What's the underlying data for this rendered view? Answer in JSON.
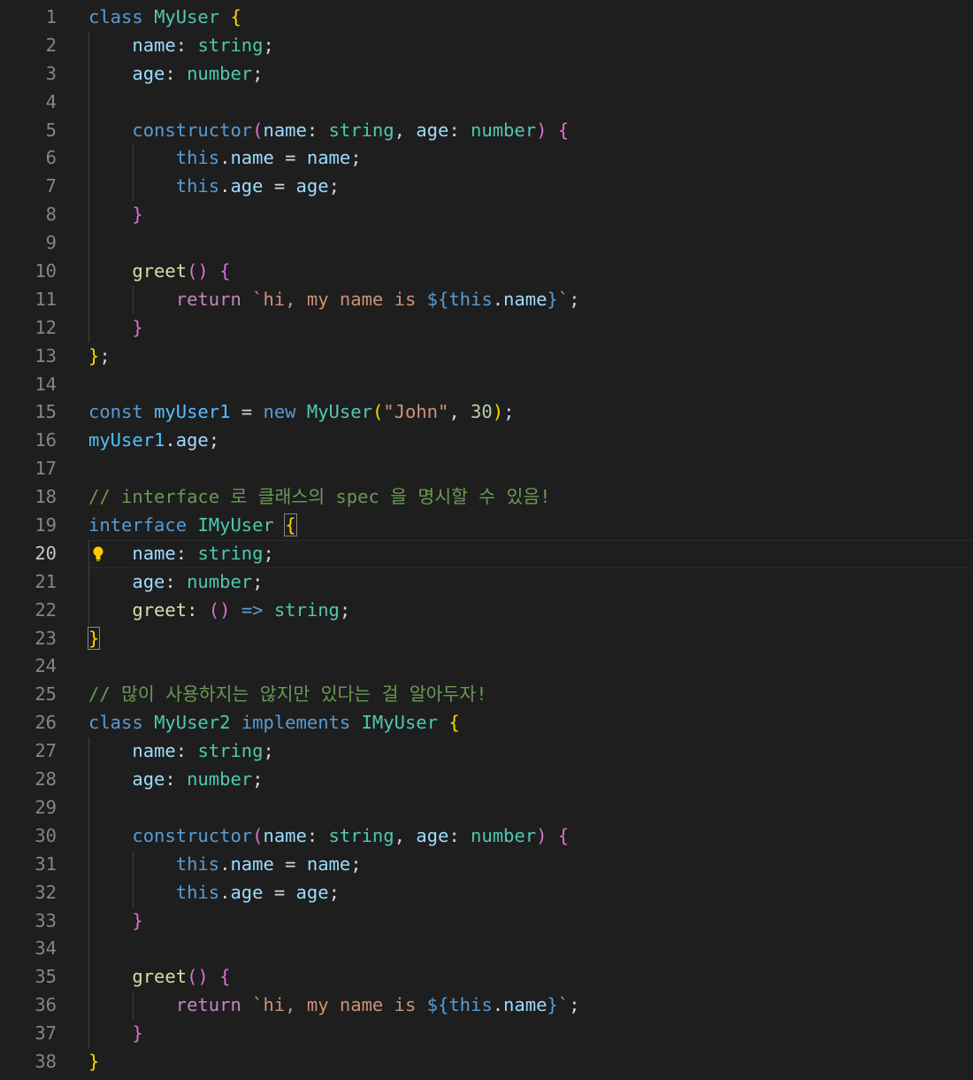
{
  "editor": {
    "current_line": 20,
    "lines": [
      {
        "n": "1",
        "tokens": [
          {
            "t": "class",
            "c": "kw"
          },
          {
            "t": " ",
            "c": "pun"
          },
          {
            "t": "MyUser",
            "c": "cls"
          },
          {
            "t": " ",
            "c": "pun"
          },
          {
            "t": "{",
            "c": "b1"
          }
        ]
      },
      {
        "n": "2",
        "tokens": [
          {
            "t": "    ",
            "c": "pun"
          },
          {
            "t": "name",
            "c": "var"
          },
          {
            "t": ": ",
            "c": "pun"
          },
          {
            "t": "string",
            "c": "cls"
          },
          {
            "t": ";",
            "c": "pun"
          }
        ]
      },
      {
        "n": "3",
        "tokens": [
          {
            "t": "    ",
            "c": "pun"
          },
          {
            "t": "age",
            "c": "var"
          },
          {
            "t": ": ",
            "c": "pun"
          },
          {
            "t": "number",
            "c": "cls"
          },
          {
            "t": ";",
            "c": "pun"
          }
        ]
      },
      {
        "n": "4",
        "tokens": []
      },
      {
        "n": "5",
        "tokens": [
          {
            "t": "    ",
            "c": "pun"
          },
          {
            "t": "constructor",
            "c": "kw"
          },
          {
            "t": "(",
            "c": "b2"
          },
          {
            "t": "name",
            "c": "var"
          },
          {
            "t": ": ",
            "c": "pun"
          },
          {
            "t": "string",
            "c": "cls"
          },
          {
            "t": ", ",
            "c": "pun"
          },
          {
            "t": "age",
            "c": "var"
          },
          {
            "t": ": ",
            "c": "pun"
          },
          {
            "t": "number",
            "c": "cls"
          },
          {
            "t": ")",
            "c": "b2"
          },
          {
            "t": " ",
            "c": "pun"
          },
          {
            "t": "{",
            "c": "b2"
          }
        ]
      },
      {
        "n": "6",
        "tokens": [
          {
            "t": "        ",
            "c": "pun"
          },
          {
            "t": "this",
            "c": "kw"
          },
          {
            "t": ".",
            "c": "pun"
          },
          {
            "t": "name",
            "c": "var"
          },
          {
            "t": " = ",
            "c": "pun"
          },
          {
            "t": "name",
            "c": "var"
          },
          {
            "t": ";",
            "c": "pun"
          }
        ]
      },
      {
        "n": "7",
        "tokens": [
          {
            "t": "        ",
            "c": "pun"
          },
          {
            "t": "this",
            "c": "kw"
          },
          {
            "t": ".",
            "c": "pun"
          },
          {
            "t": "age",
            "c": "var"
          },
          {
            "t": " = ",
            "c": "pun"
          },
          {
            "t": "age",
            "c": "var"
          },
          {
            "t": ";",
            "c": "pun"
          }
        ]
      },
      {
        "n": "8",
        "tokens": [
          {
            "t": "    ",
            "c": "pun"
          },
          {
            "t": "}",
            "c": "b2"
          }
        ]
      },
      {
        "n": "9",
        "tokens": []
      },
      {
        "n": "10",
        "tokens": [
          {
            "t": "    ",
            "c": "pun"
          },
          {
            "t": "greet",
            "c": "fn"
          },
          {
            "t": "()",
            "c": "b2"
          },
          {
            "t": " ",
            "c": "pun"
          },
          {
            "t": "{",
            "c": "b2"
          }
        ]
      },
      {
        "n": "11",
        "tokens": [
          {
            "t": "        ",
            "c": "pun"
          },
          {
            "t": "return",
            "c": "ctl"
          },
          {
            "t": " ",
            "c": "pun"
          },
          {
            "t": "`hi, my name is ",
            "c": "str"
          },
          {
            "t": "${",
            "c": "kw"
          },
          {
            "t": "this",
            "c": "kw"
          },
          {
            "t": ".",
            "c": "pun"
          },
          {
            "t": "name",
            "c": "var"
          },
          {
            "t": "}",
            "c": "kw"
          },
          {
            "t": "`",
            "c": "str"
          },
          {
            "t": ";",
            "c": "pun"
          }
        ]
      },
      {
        "n": "12",
        "tokens": [
          {
            "t": "    ",
            "c": "pun"
          },
          {
            "t": "}",
            "c": "b2"
          }
        ]
      },
      {
        "n": "13",
        "tokens": [
          {
            "t": "}",
            "c": "b1"
          },
          {
            "t": ";",
            "c": "pun"
          }
        ]
      },
      {
        "n": "14",
        "tokens": []
      },
      {
        "n": "15",
        "tokens": [
          {
            "t": "const",
            "c": "kw"
          },
          {
            "t": " ",
            "c": "pun"
          },
          {
            "t": "myUser1",
            "c": "cst"
          },
          {
            "t": " = ",
            "c": "pun"
          },
          {
            "t": "new",
            "c": "kw"
          },
          {
            "t": " ",
            "c": "pun"
          },
          {
            "t": "MyUser",
            "c": "cls"
          },
          {
            "t": "(",
            "c": "b1"
          },
          {
            "t": "\"John\"",
            "c": "str"
          },
          {
            "t": ", ",
            "c": "pun"
          },
          {
            "t": "30",
            "c": "num"
          },
          {
            "t": ")",
            "c": "b1"
          },
          {
            "t": ";",
            "c": "pun"
          }
        ]
      },
      {
        "n": "16",
        "tokens": [
          {
            "t": "myUser1",
            "c": "cst"
          },
          {
            "t": ".",
            "c": "pun"
          },
          {
            "t": "age",
            "c": "var"
          },
          {
            "t": ";",
            "c": "pun"
          }
        ]
      },
      {
        "n": "17",
        "tokens": []
      },
      {
        "n": "18",
        "tokens": [
          {
            "t": "// interface 로 클래스의 spec 을 명시할 수 있음!",
            "c": "cmt"
          }
        ]
      },
      {
        "n": "19",
        "tokens": [
          {
            "t": "interface",
            "c": "kw"
          },
          {
            "t": " ",
            "c": "pun"
          },
          {
            "t": "IMyUser",
            "c": "cls"
          },
          {
            "t": " ",
            "c": "pun"
          },
          {
            "t": "{",
            "c": "b1m"
          }
        ]
      },
      {
        "n": "20",
        "tokens": [
          {
            "t": "    ",
            "c": "pun"
          },
          {
            "t": "name",
            "c": "var"
          },
          {
            "t": ": ",
            "c": "pun"
          },
          {
            "t": "string",
            "c": "cls"
          },
          {
            "t": ";",
            "c": "pun"
          }
        ]
      },
      {
        "n": "21",
        "tokens": [
          {
            "t": "    ",
            "c": "pun"
          },
          {
            "t": "age",
            "c": "var"
          },
          {
            "t": ": ",
            "c": "pun"
          },
          {
            "t": "number",
            "c": "cls"
          },
          {
            "t": ";",
            "c": "pun"
          }
        ]
      },
      {
        "n": "22",
        "tokens": [
          {
            "t": "    ",
            "c": "pun"
          },
          {
            "t": "greet",
            "c": "fn"
          },
          {
            "t": ": ",
            "c": "pun"
          },
          {
            "t": "()",
            "c": "b2"
          },
          {
            "t": " ",
            "c": "pun"
          },
          {
            "t": "=>",
            "c": "kw"
          },
          {
            "t": " ",
            "c": "pun"
          },
          {
            "t": "string",
            "c": "cls"
          },
          {
            "t": ";",
            "c": "pun"
          }
        ]
      },
      {
        "n": "23",
        "tokens": [
          {
            "t": "}",
            "c": "b1m"
          }
        ]
      },
      {
        "n": "24",
        "tokens": []
      },
      {
        "n": "25",
        "tokens": [
          {
            "t": "// 많이 사용하지는 않지만 있다는 걸 알아두자!",
            "c": "cmt"
          }
        ]
      },
      {
        "n": "26",
        "tokens": [
          {
            "t": "class",
            "c": "kw"
          },
          {
            "t": " ",
            "c": "pun"
          },
          {
            "t": "MyUser2",
            "c": "cls"
          },
          {
            "t": " ",
            "c": "pun"
          },
          {
            "t": "implements",
            "c": "kw"
          },
          {
            "t": " ",
            "c": "pun"
          },
          {
            "t": "IMyUser",
            "c": "cls"
          },
          {
            "t": " ",
            "c": "pun"
          },
          {
            "t": "{",
            "c": "b1"
          }
        ]
      },
      {
        "n": "27",
        "tokens": [
          {
            "t": "    ",
            "c": "pun"
          },
          {
            "t": "name",
            "c": "var"
          },
          {
            "t": ": ",
            "c": "pun"
          },
          {
            "t": "string",
            "c": "cls"
          },
          {
            "t": ";",
            "c": "pun"
          }
        ]
      },
      {
        "n": "28",
        "tokens": [
          {
            "t": "    ",
            "c": "pun"
          },
          {
            "t": "age",
            "c": "var"
          },
          {
            "t": ": ",
            "c": "pun"
          },
          {
            "t": "number",
            "c": "cls"
          },
          {
            "t": ";",
            "c": "pun"
          }
        ]
      },
      {
        "n": "29",
        "tokens": []
      },
      {
        "n": "30",
        "tokens": [
          {
            "t": "    ",
            "c": "pun"
          },
          {
            "t": "constructor",
            "c": "kw"
          },
          {
            "t": "(",
            "c": "b2"
          },
          {
            "t": "name",
            "c": "var"
          },
          {
            "t": ": ",
            "c": "pun"
          },
          {
            "t": "string",
            "c": "cls"
          },
          {
            "t": ", ",
            "c": "pun"
          },
          {
            "t": "age",
            "c": "var"
          },
          {
            "t": ": ",
            "c": "pun"
          },
          {
            "t": "number",
            "c": "cls"
          },
          {
            "t": ")",
            "c": "b2"
          },
          {
            "t": " ",
            "c": "pun"
          },
          {
            "t": "{",
            "c": "b2"
          }
        ]
      },
      {
        "n": "31",
        "tokens": [
          {
            "t": "        ",
            "c": "pun"
          },
          {
            "t": "this",
            "c": "kw"
          },
          {
            "t": ".",
            "c": "pun"
          },
          {
            "t": "name",
            "c": "var"
          },
          {
            "t": " = ",
            "c": "pun"
          },
          {
            "t": "name",
            "c": "var"
          },
          {
            "t": ";",
            "c": "pun"
          }
        ]
      },
      {
        "n": "32",
        "tokens": [
          {
            "t": "        ",
            "c": "pun"
          },
          {
            "t": "this",
            "c": "kw"
          },
          {
            "t": ".",
            "c": "pun"
          },
          {
            "t": "age",
            "c": "var"
          },
          {
            "t": " = ",
            "c": "pun"
          },
          {
            "t": "age",
            "c": "var"
          },
          {
            "t": ";",
            "c": "pun"
          }
        ]
      },
      {
        "n": "33",
        "tokens": [
          {
            "t": "    ",
            "c": "pun"
          },
          {
            "t": "}",
            "c": "b2"
          }
        ]
      },
      {
        "n": "34",
        "tokens": []
      },
      {
        "n": "35",
        "tokens": [
          {
            "t": "    ",
            "c": "pun"
          },
          {
            "t": "greet",
            "c": "fn"
          },
          {
            "t": "()",
            "c": "b2"
          },
          {
            "t": " ",
            "c": "pun"
          },
          {
            "t": "{",
            "c": "b2"
          }
        ]
      },
      {
        "n": "36",
        "tokens": [
          {
            "t": "        ",
            "c": "pun"
          },
          {
            "t": "return",
            "c": "ctl"
          },
          {
            "t": " ",
            "c": "pun"
          },
          {
            "t": "`hi, my name is ",
            "c": "str"
          },
          {
            "t": "${",
            "c": "kw"
          },
          {
            "t": "this",
            "c": "kw"
          },
          {
            "t": ".",
            "c": "pun"
          },
          {
            "t": "name",
            "c": "var"
          },
          {
            "t": "}",
            "c": "kw"
          },
          {
            "t": "`",
            "c": "str"
          },
          {
            "t": ";",
            "c": "pun"
          }
        ]
      },
      {
        "n": "37",
        "tokens": [
          {
            "t": "    ",
            "c": "pun"
          },
          {
            "t": "}",
            "c": "b2"
          }
        ]
      },
      {
        "n": "38",
        "tokens": [
          {
            "t": "}",
            "c": "b1"
          }
        ]
      }
    ]
  },
  "icons": {
    "lightbulb": "lightbulb-icon"
  },
  "colors": {
    "background": "#1e1e1e",
    "line_number": "#858585",
    "keyword": "#569cd6",
    "control": "#c586c0",
    "type": "#4ec9b0",
    "function": "#dcdcaa",
    "variable": "#9cdcfe",
    "constant": "#4fc1ff",
    "string": "#ce9178",
    "number": "#b5cea8",
    "comment": "#6a9955",
    "bracket_1": "#ffd700",
    "bracket_2": "#da70d6",
    "lightbulb": "#ffcc00"
  }
}
